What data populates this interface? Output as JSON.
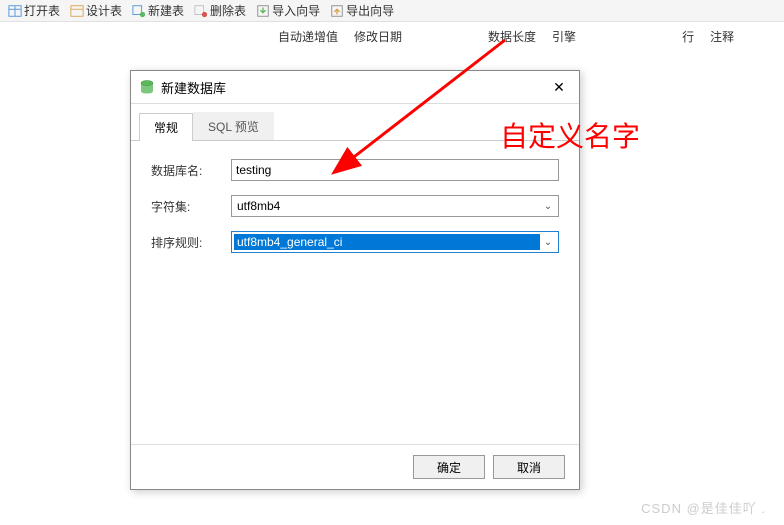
{
  "toolbar": {
    "items": [
      {
        "label": "打开表"
      },
      {
        "label": "设计表"
      },
      {
        "label": "新建表"
      },
      {
        "label": "删除表"
      },
      {
        "label": "导入向导"
      },
      {
        "label": "导出向导"
      }
    ]
  },
  "columns": {
    "auto_increment": "自动递增值",
    "modify_date": "修改日期",
    "data_length": "数据长度",
    "engine": "引擎",
    "rows": "行",
    "comment": "注释"
  },
  "dialog": {
    "title": "新建数据库",
    "tabs": {
      "general": "常规",
      "sql_preview": "SQL 预览"
    },
    "fields": {
      "db_name_label": "数据库名:",
      "db_name_value": "testing",
      "charset_label": "字符集:",
      "charset_value": "utf8mb4",
      "collation_label": "排序规则:",
      "collation_value": "utf8mb4_general_ci"
    },
    "buttons": {
      "ok": "确定",
      "cancel": "取消"
    }
  },
  "annotation": "自定义名字",
  "watermark": "CSDN @是佳佳吖   ."
}
